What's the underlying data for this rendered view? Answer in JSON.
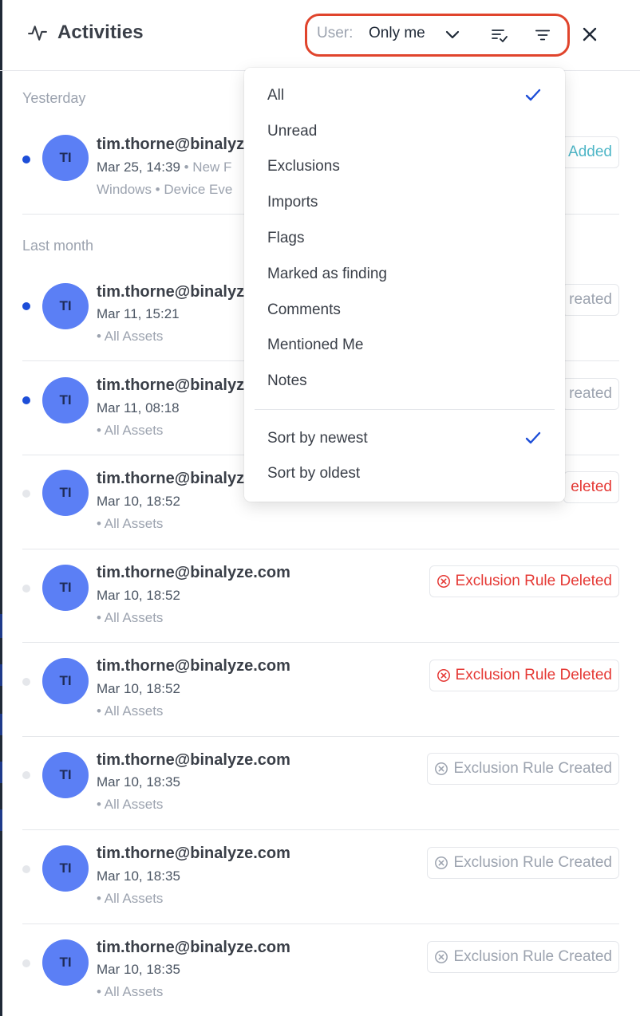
{
  "header": {
    "title": "Activities",
    "user_label": "User:",
    "user_value": "Only me"
  },
  "sections": {
    "yesterday": "Yesterday",
    "last_month": "Last month"
  },
  "menu": {
    "items": [
      "All",
      "Unread",
      "Exclusions",
      "Imports",
      "Flags",
      "Marked as finding",
      "Comments",
      "Mentioned Me",
      "Notes"
    ],
    "selected_filter": "All",
    "sort_items": [
      "Sort by newest",
      "Sort by oldest"
    ],
    "selected_sort": "Sort by newest"
  },
  "activities": [
    {
      "initials": "TI",
      "user": "tim.thorne@binalyze.com",
      "time": "Mar 25, 14:39",
      "extra": " • New F",
      "meta": "Windows • Device Eve",
      "badge": "Added",
      "badge_type": "added",
      "unread": true
    },
    {
      "initials": "TI",
      "user": "tim.thorne@binalyze.com",
      "time": "Mar 11, 15:21",
      "meta": "• All Assets",
      "badge": "reated",
      "badge_type": "created",
      "unread": true
    },
    {
      "initials": "TI",
      "user": "tim.thorne@binalyze.com",
      "time": "Mar 11, 08:18",
      "meta": "• All Assets",
      "badge": "reated",
      "badge_type": "created",
      "unread": true
    },
    {
      "initials": "TI",
      "user": "tim.thorne@binalyze.com",
      "time": "Mar 10, 18:52",
      "meta": "• All Assets",
      "badge": "eleted",
      "badge_type": "deleted",
      "unread": false
    },
    {
      "initials": "TI",
      "user": "tim.thorne@binalyze.com",
      "time": "Mar 10, 18:52",
      "meta": "• All Assets",
      "badge": "Exclusion Rule Deleted",
      "badge_type": "deleted",
      "unread": false
    },
    {
      "initials": "TI",
      "user": "tim.thorne@binalyze.com",
      "time": "Mar 10, 18:52",
      "meta": "• All Assets",
      "badge": "Exclusion Rule Deleted",
      "badge_type": "deleted",
      "unread": false
    },
    {
      "initials": "TI",
      "user": "tim.thorne@binalyze.com",
      "time": "Mar 10, 18:35",
      "meta": "• All Assets",
      "badge": "Exclusion Rule Created",
      "badge_type": "created",
      "unread": false
    },
    {
      "initials": "TI",
      "user": "tim.thorne@binalyze.com",
      "time": "Mar 10, 18:35",
      "meta": "• All Assets",
      "badge": "Exclusion Rule Created",
      "badge_type": "created",
      "unread": false
    },
    {
      "initials": "TI",
      "user": "tim.thorne@binalyze.com",
      "time": "Mar 10, 18:35",
      "meta": "• All Assets",
      "badge": "Exclusion Rule Created",
      "badge_type": "created",
      "unread": false
    }
  ],
  "colors": {
    "accent": "#1d4ed8",
    "avatar": "#5b7ff5",
    "deleted": "#e53935",
    "added": "#4fb6c7",
    "highlight": "#e0442c"
  },
  "icons": {
    "title": "activity-pulse-icon",
    "user_dropdown": "chevron-down-icon",
    "sort": "sort-check-icon",
    "filter": "filter-icon",
    "close": "close-icon",
    "badge": "x-circle-icon",
    "selected": "checkmark-icon"
  }
}
